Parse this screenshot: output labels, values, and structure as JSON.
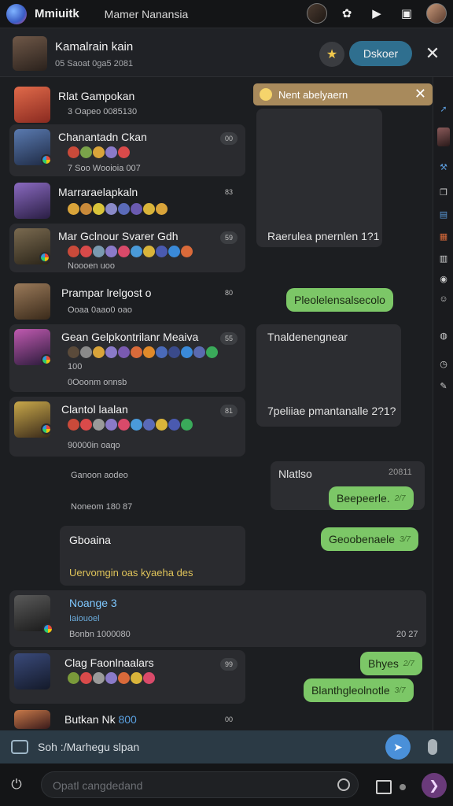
{
  "app": {
    "name": "Mmiuitk",
    "window_title": "Mamer Nanansia"
  },
  "header": {
    "title": "Kamalrain kain",
    "subtitle": "05 Saoat 0ga5 2081",
    "primary_button": "Dskoer"
  },
  "notification": {
    "text": "Nent abelyaern"
  },
  "conversations": [
    {
      "name": "Rlat Gampokan",
      "meta": "3 Oapeo 0085130",
      "count": ""
    },
    {
      "name": "Chanantadn Ckan",
      "meta": "7 Soo Wooioia 007",
      "count": "00"
    },
    {
      "name": "Marraraelapkaln",
      "meta": "",
      "count": "83"
    },
    {
      "name": "Mar Gclnour Svarer Gdh",
      "meta": "Noooen uoo",
      "count": "59"
    },
    {
      "name": "Prampar lrelgost o",
      "meta": "Ooaa 0aao0 oao",
      "count": "80"
    },
    {
      "name": "Gean Gelpkontrilanr Meaiva",
      "meta": "0Ooonm onnsb",
      "extra": "100",
      "count": "55"
    },
    {
      "name": "Clantol laalan",
      "meta": "90000in oaqo",
      "count": "81"
    },
    {
      "name": "",
      "meta": "Ganoon aodeo",
      "count": ""
    },
    {
      "name": "",
      "meta": "Noneom 180 87",
      "count": ""
    },
    {
      "name": "Gboaina",
      "meta": "Uervomgin oas kyaeha des",
      "count": ""
    },
    {
      "name": "Noange 3",
      "sub": "Iaiouoel",
      "meta": "Bonbn 1000080",
      "time": "20 27",
      "count": ""
    },
    {
      "name": "Clag Faonlnaalars",
      "meta": "",
      "count": "99"
    },
    {
      "name": "Butkan Nk",
      "name_suffix": "800",
      "count": "00"
    }
  ],
  "panels": [
    {
      "text": "Raerulea pnernlen 1?1"
    },
    {
      "text": "Tnaldenengnear",
      "text2": "7peliiae pmantanalle 2?1?"
    },
    {
      "text": "Nlatlso",
      "time": "20811"
    }
  ],
  "bubbles": [
    {
      "text": "Pleolelensalsecolo"
    },
    {
      "text": "Beepeerle.",
      "tick": "2/7"
    },
    {
      "text": "Geoobenaele",
      "tick": "3/7"
    },
    {
      "text": "Bhyes",
      "tick": "2/7"
    },
    {
      "text": "Blanthgleolnotle",
      "tick": "3/7"
    }
  ],
  "composer": {
    "text": "Soh :/Marhegu slpan"
  },
  "search": {
    "placeholder": "Opatl cangdedand"
  },
  "icons": {
    "logo": "app-logo-icon",
    "gear": "gear-icon",
    "video": "video-icon",
    "window": "window-icon",
    "star": "star-icon",
    "close": "close-icon",
    "image": "image-icon",
    "send": "send-icon",
    "mic": "mic-icon"
  },
  "colors": {
    "accent_green": "#7cc767",
    "panel": "#2c2d31",
    "primary_button": "#2f6f8f",
    "notification": "#a88a5c"
  }
}
